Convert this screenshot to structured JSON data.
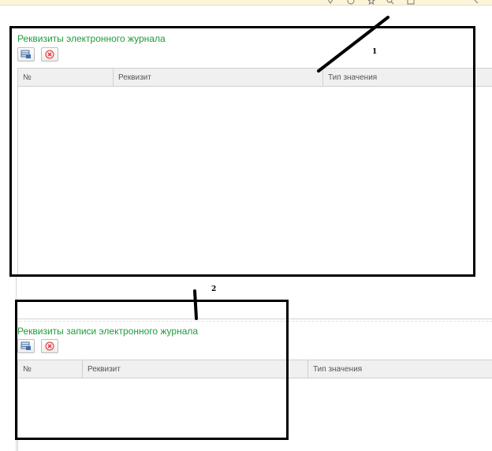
{
  "section1": {
    "title": "Реквизиты электронного журнала",
    "columns": {
      "number": "№",
      "attribute": "Реквизит",
      "value_type": "Тип значения"
    }
  },
  "section2": {
    "title": "Реквизиты записи электронного журнала",
    "columns": {
      "number": "№",
      "attribute": "Реквизит",
      "value_type": "Тип значения"
    }
  },
  "annotations": {
    "label1": "1",
    "label2": "2"
  },
  "colors": {
    "title_green": "#1e9b3a",
    "topbar": "#fbf4d8",
    "delete_red": "#e03030",
    "annotation": "#000000"
  },
  "icons": [
    "add-row-icon",
    "delete-icon",
    "topbar-icons"
  ]
}
